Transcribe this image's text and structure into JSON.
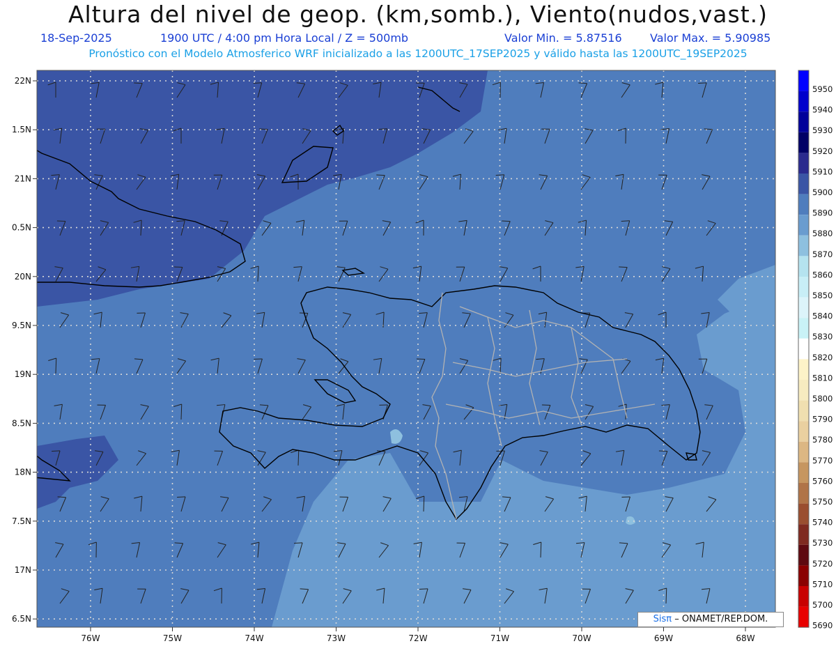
{
  "header": {
    "title": "Altura del nivel de geop. (km,somb.), Viento(nudos,vast.)",
    "date": "18-Sep-2025",
    "time": "1900 UTC / 4:00 pm Hora Local / Z = 500mb",
    "min": "Valor Min. = 5.87516",
    "max": "Valor Max. = 5.90985",
    "subtitle": "Pronóstico con el Modelo Atmosferico WRF inicializado a las 1200UTC_17SEP2025 y válido hasta las  1200UTC_19SEP2025"
  },
  "credit": {
    "brand": "Sisπ",
    "text": "ONAMET/REP.DOM."
  },
  "colors": {
    "level_5900": "#3a55a5",
    "level_5890": "#4f7dbd",
    "level_5880": "#6a9ccf",
    "level_5870": "#8ec0df",
    "level_5860": "#b5e3ef",
    "coast": "#000000",
    "borders": "#b3b3b3"
  },
  "chart_data": {
    "type": "map",
    "lon_labels": [
      "76W",
      "75W",
      "74W",
      "73W",
      "72W",
      "71W",
      "70W",
      "69W",
      "68W"
    ],
    "lat_labels": [
      "22N",
      "1.5N",
      "21N",
      "0.5N",
      "20N",
      "9.5N",
      "19N",
      "8.5N",
      "18N",
      "7.5N",
      "17N",
      "6.5N"
    ],
    "colorbar": {
      "labels": [
        "5950",
        "5940",
        "5930",
        "5920",
        "5910",
        "5900",
        "5890",
        "5880",
        "5870",
        "5860",
        "5850",
        "5840",
        "5830",
        "5820",
        "5810",
        "5800",
        "5790",
        "5780",
        "5770",
        "5760",
        "5750",
        "5740",
        "5730",
        "5720",
        "5710",
        "5700",
        "5690"
      ],
      "colors": [
        "#0000ff",
        "#0000cc",
        "#00009a",
        "#000066",
        "#2a2a8e",
        "#3a55a5",
        "#4f7dbd",
        "#6a9ccf",
        "#8ec0df",
        "#b5e3ef",
        "#c8eef6",
        "#dcf4fa",
        "#c9f2f6",
        "#ffffff",
        "#fdf3c8",
        "#f6ebc0",
        "#f0dfb0",
        "#ead0a0",
        "#dcb783",
        "#c69660",
        "#b07448",
        "#9a4e30",
        "#7f2a20",
        "#5e0a10",
        "#8a0000",
        "#c80000",
        "#e80000"
      ]
    }
  }
}
